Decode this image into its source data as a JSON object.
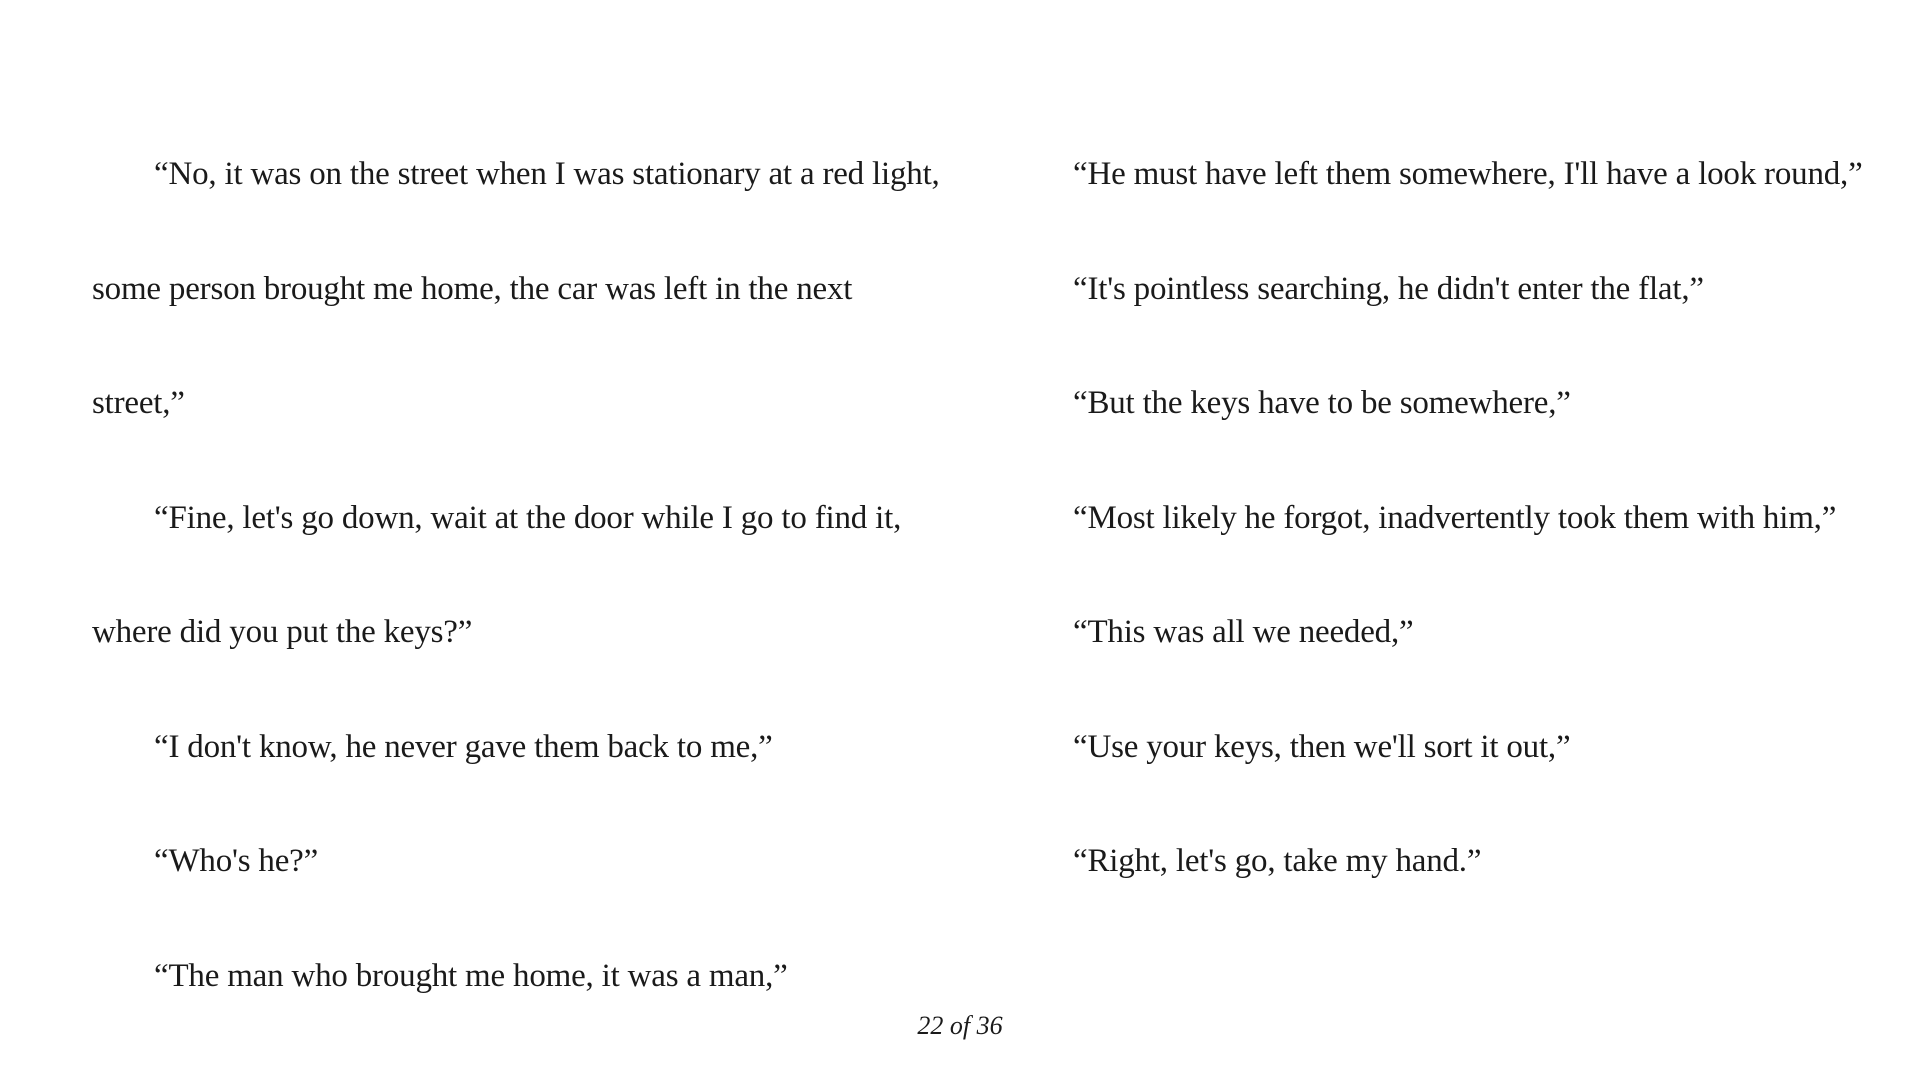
{
  "reader": {
    "left_column": [
      {
        "text": "“No, it was on the street when I was stationary at a red light,",
        "indent": true
      },
      {
        "text": "some person brought me home, the car was left in the next",
        "indent": false
      },
      {
        "text": "street,”",
        "indent": false
      },
      {
        "text": "“Fine, let's go down, wait at the door while I go to find it,",
        "indent": true
      },
      {
        "text": "where did you put the keys?”",
        "indent": false
      },
      {
        "text": "“I don't know, he never gave them back to me,”",
        "indent": true
      },
      {
        "text": "“Who's he?”",
        "indent": true
      },
      {
        "text": "“The man who brought me home, it was a man,”",
        "indent": true
      }
    ],
    "right_column": [
      {
        "text": "“He must have left them somewhere, I'll have a look round,”"
      },
      {
        "text": "“It's pointless searching, he didn't enter the flat,”"
      },
      {
        "text": "“But the keys have to be somewhere,”"
      },
      {
        "text": "“Most likely he forgot, inadvertently took them with him,”"
      },
      {
        "text": "“This was all we needed,”"
      },
      {
        "text": "“Use your keys, then we'll sort it out,”"
      },
      {
        "text": "“Right, let's go, take my hand.”"
      }
    ],
    "page_indicator": "22 of 36"
  }
}
